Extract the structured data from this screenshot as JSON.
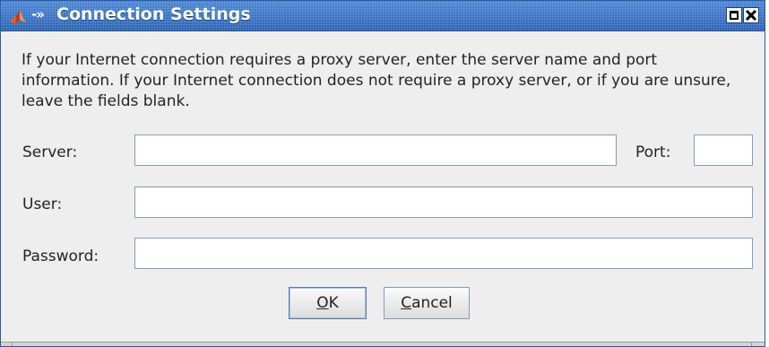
{
  "window": {
    "title": "Connection Settings",
    "title_glyph": "-»",
    "maximize_icon": "maximize-icon",
    "close_icon": "close-icon"
  },
  "message": "If your Internet connection requires a proxy server, enter the server name and port information. If your Internet connection does not require a proxy server, or if you are unsure, leave the fields blank.",
  "form": {
    "server_label": "Server:",
    "server_value": "",
    "port_label": "Port:",
    "port_value": "",
    "user_label": "User:",
    "user_value": "",
    "password_label": "Password:",
    "password_value": ""
  },
  "buttons": {
    "ok_mnemonic": "O",
    "ok_rest": "K",
    "cancel_mnemonic": "C",
    "cancel_rest": "ancel"
  },
  "colors": {
    "titlebar": "#2b63b5",
    "background": "#eeeeee",
    "field_border": "#7f9db9"
  }
}
